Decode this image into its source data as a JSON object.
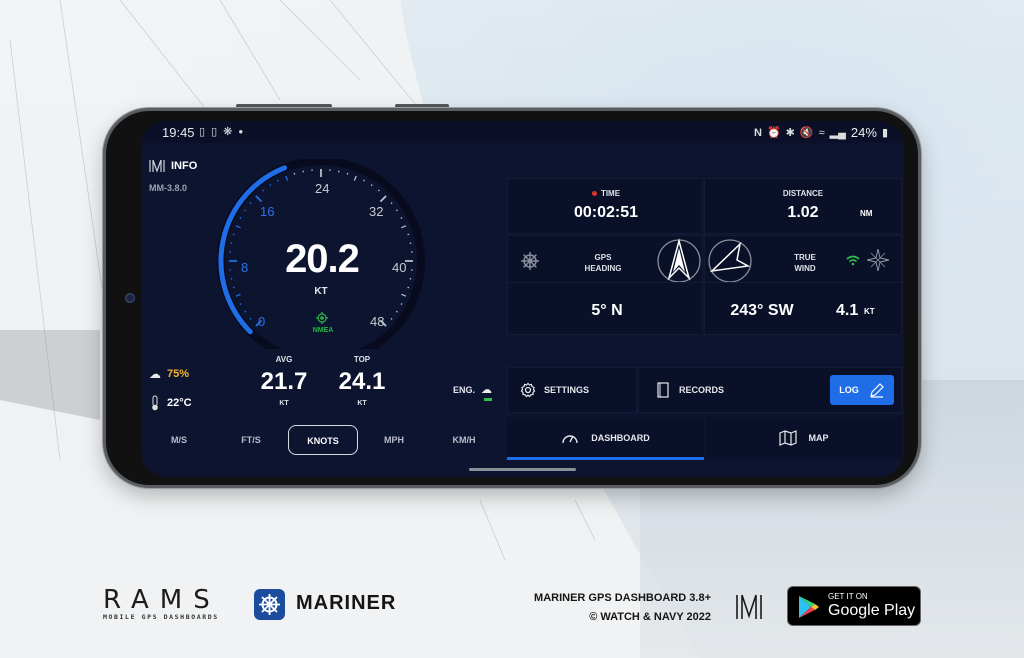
{
  "status_bar": {
    "time": "19:45",
    "left_icons": [
      "sim-icon",
      "sim-icon",
      "helm-icon",
      "dot-icon"
    ],
    "right_icons": [
      "nfc-icon",
      "alarm-icon",
      "bluetooth-icon",
      "mute-icon",
      "wifi-icon",
      "signal-icon"
    ],
    "battery": "24%"
  },
  "app": {
    "info_label": "INFO",
    "version": "MM-3.8.0"
  },
  "gauge": {
    "speed": "20.2",
    "unit": "KT",
    "source": "NMEA",
    "tick_labels": [
      "0",
      "8",
      "16",
      "24",
      "32",
      "40",
      "48"
    ],
    "max_value": 48,
    "current_value": 20.2,
    "accent_color": "#1f6ee8"
  },
  "weather": {
    "cloud_cover": "75%",
    "temperature": "22°C"
  },
  "stats": {
    "avg_label": "AVG",
    "avg_value": "21.7",
    "avg_unit": "KT",
    "top_label": "TOP",
    "top_value": "24.1",
    "top_unit": "KT"
  },
  "engine": {
    "label": "ENG."
  },
  "units": {
    "options": [
      "M/S",
      "FT/S",
      "KNOTS",
      "MPH",
      "KM/H"
    ],
    "selected": "KNOTS"
  },
  "cards": {
    "time_label": "TIME",
    "time_value": "00:02:51",
    "distance_label": "DISTANCE",
    "distance_value": "1.02",
    "distance_unit": "NM",
    "gps_heading_label_1": "GPS",
    "gps_heading_label_2": "HEADING",
    "gps_heading_value": "5° N",
    "true_wind_label_1": "TRUE",
    "true_wind_label_2": "WIND",
    "true_wind_direction": "243° SW",
    "true_wind_speed": "4.1",
    "true_wind_unit": "KT"
  },
  "actions": {
    "settings_label": "SETTINGS",
    "records_label": "RECORDS",
    "log_label": "LOG"
  },
  "tabs": {
    "dashboard_label": "DASHBOARD",
    "map_label": "MAP",
    "active": "DASHBOARD"
  },
  "footer": {
    "rams_word": "RAMS",
    "rams_sub": "MOBILE GPS DASHBOARDS",
    "mariner_word": "MARINER",
    "credits_line1": "MARINER GPS DASHBOARD 3.8+",
    "credits_line2": "© WATCH & NAVY 2022",
    "gplay_small": "GET IT ON",
    "gplay_big": "Google Play"
  }
}
